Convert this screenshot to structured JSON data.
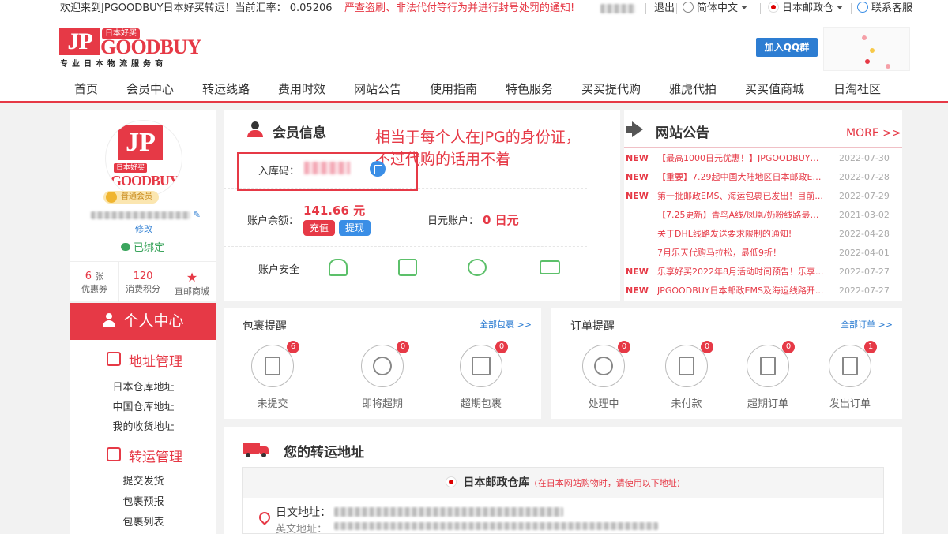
{
  "topbar": {
    "welcome": "欢迎来到JPGOODBUY日本好买转运！当前汇率：",
    "rate": "0.05206",
    "notice": "严查盗刷、非法代付等行为并进行封号处罚的通知!",
    "logout": "退出",
    "language": "简体中文",
    "warehouse": "日本邮政仓",
    "customer_service": "联系客服"
  },
  "header": {
    "logo_jp": "JP",
    "logo_badge": "日本好买",
    "logo_goodbuy": "GOODBUY",
    "logo_sub": "专业日本物流服务商",
    "qq_button": "加入QQ群",
    "nav": [
      "首页",
      "会员中心",
      "转运线路",
      "费用时效",
      "网站公告",
      "使用指南",
      "特色服务",
      "买买提代购",
      "雅虎代拍",
      "买买值商城",
      "日淘社区"
    ]
  },
  "profile": {
    "avatar_jp": "JP",
    "avatar_badge": "日本好买",
    "avatar_goodbuy": "GOODBUY",
    "level": "普通会员",
    "modify": "修改",
    "bound": "已绑定",
    "stats": [
      {
        "value": "6",
        "unit": "张",
        "label": "优惠券"
      },
      {
        "value": "120",
        "unit": "",
        "label": "消费积分"
      },
      {
        "value": "",
        "unit": "",
        "label": "直邮商城"
      }
    ]
  },
  "sidebar": {
    "title": "个人中心",
    "groups": [
      {
        "title": "地址管理",
        "items": [
          "日本仓库地址",
          "中国仓库地址",
          "我的收货地址"
        ]
      },
      {
        "title": "转运管理",
        "items": [
          "提交发货",
          "包裹预报",
          "包裹列表"
        ]
      }
    ]
  },
  "member_info": {
    "title": "会员信息",
    "annotation_line1": "相当于每个人在JPG的身份证，",
    "annotation_line2": "不过代购的话用不着",
    "storage_code_label": "入库码：",
    "balance_label": "账户余额：",
    "balance_value": "141.66 元",
    "recharge": "充值",
    "withdraw": "提现",
    "yen_label": "日元账户：",
    "yen_value": "0 日元",
    "security_label": "账户安全"
  },
  "news": {
    "title": "网站公告",
    "more": "MORE >>",
    "items": [
      {
        "tag": "NEW",
        "text": "【最高1000日元优惠！】JPGOODBUY&...",
        "date": "2022-07-30"
      },
      {
        "tag": "NEW",
        "text": "【重要】7.29起中国大陆地区日本邮政EM...",
        "date": "2022-07-28"
      },
      {
        "tag": "NEW",
        "text": "第一批邮政EMS、海运包裹已发出！目前...",
        "date": "2022-07-29"
      },
      {
        "tag": "",
        "text": "【7.25更新】青鸟A线/凤凰/奶粉线路最新...",
        "date": "2021-03-02"
      },
      {
        "tag": "",
        "text": "关于DHL线路发送要求限制的通知!",
        "date": "2022-04-28"
      },
      {
        "tag": "",
        "text": "7月乐天代购马拉松，最低9折！",
        "date": "2022-04-01"
      },
      {
        "tag": "NEW",
        "text": "乐享好买2022年8月活动时间预告！乐享...",
        "date": "2022-07-27"
      },
      {
        "tag": "NEW",
        "text": "JPGOODBUY日本邮政EMS及海运线路开...",
        "date": "2022-07-27"
      }
    ]
  },
  "package_reminder": {
    "title": "包裹提醒",
    "all": "全部包裹 >>",
    "items": [
      {
        "label": "未提交",
        "count": "6",
        "icon": "document-edit-icon"
      },
      {
        "label": "即将超期",
        "count": "0",
        "icon": "clock-icon"
      },
      {
        "label": "超期包裹",
        "count": "0",
        "icon": "box-icon"
      }
    ]
  },
  "order_reminder": {
    "title": "订单提醒",
    "all": "全部订单 >>",
    "items": [
      {
        "label": "处理中",
        "count": "0",
        "icon": "clock-refresh-icon"
      },
      {
        "label": "未付款",
        "count": "0",
        "icon": "yen-icon"
      },
      {
        "label": "超期订单",
        "count": "0",
        "icon": "order-clock-icon"
      },
      {
        "label": "发出订单",
        "count": "1",
        "icon": "share-out-icon"
      }
    ]
  },
  "address": {
    "title": "您的转运地址",
    "warehouse_name": "日本邮政仓库",
    "warehouse_note": "(在日本网站购物时，请使用以下地址)",
    "jp_address_label": "日文地址：",
    "en_address_label": "英文地址："
  },
  "colors": {
    "accent": "#e63946",
    "blue": "#2d7dd2",
    "green": "#5cc06a"
  }
}
